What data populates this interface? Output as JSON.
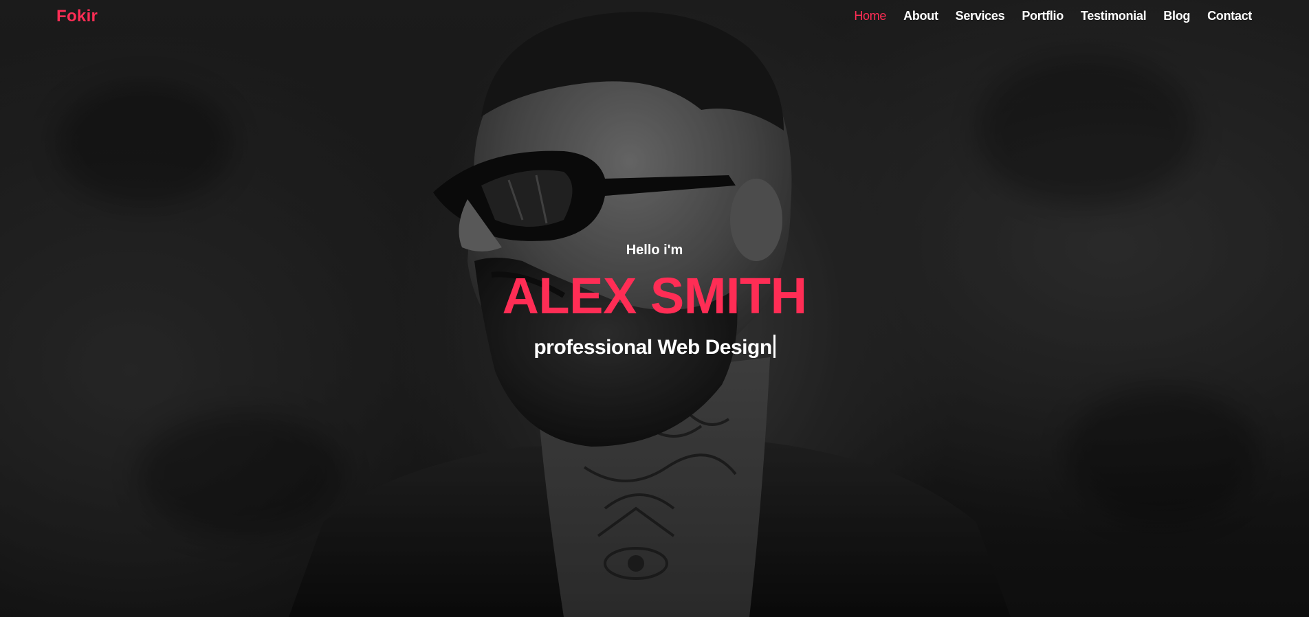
{
  "navbar": {
    "logo": "Fokir",
    "items": [
      {
        "label": "Home",
        "active": true
      },
      {
        "label": "About",
        "active": false
      },
      {
        "label": "Services",
        "active": false
      },
      {
        "label": "Portflio",
        "active": false
      },
      {
        "label": "Testimonial",
        "active": false
      },
      {
        "label": "Blog",
        "active": false
      },
      {
        "label": "Contact",
        "active": false
      }
    ]
  },
  "hero": {
    "greeting": "Hello i'm",
    "name": "ALEX SMITH",
    "role": "professional Web Design",
    "background_image": "grayscale-portrait-bearded-man-sunglasses-tattoos"
  },
  "colors": {
    "accent": "#ff2d55",
    "text": "#ffffff",
    "background": "#202020"
  }
}
